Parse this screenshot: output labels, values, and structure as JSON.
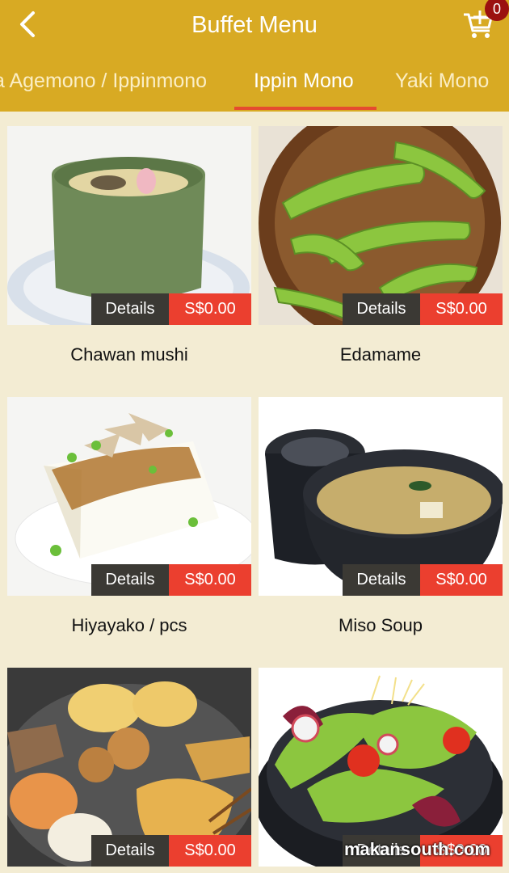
{
  "header": {
    "title": "Buffet Menu",
    "cart_count": "0"
  },
  "tabs": [
    {
      "label": "a Agemono / Ippinmono",
      "active": false
    },
    {
      "label": "Ippin Mono",
      "active": true
    },
    {
      "label": "Yaki Mono",
      "active": false
    }
  ],
  "items": [
    {
      "name": "Chawan mushi",
      "details_label": "Details",
      "price": "S$0.00"
    },
    {
      "name": "Edamame",
      "details_label": "Details",
      "price": "S$0.00"
    },
    {
      "name": "Hiyayako / pcs",
      "details_label": "Details",
      "price": "S$0.00"
    },
    {
      "name": "Miso Soup",
      "details_label": "Details",
      "price": "S$0.00"
    },
    {
      "name": "",
      "details_label": "Details",
      "price": "S$0.00"
    },
    {
      "name": "",
      "details_label": "Details",
      "price": "S$0.00"
    }
  ],
  "watermark": "makansouth.com",
  "colors": {
    "header": "#d8aa23",
    "accent": "#eb3f2f",
    "background": "#f3ecd3",
    "badge": "#9b1110"
  }
}
